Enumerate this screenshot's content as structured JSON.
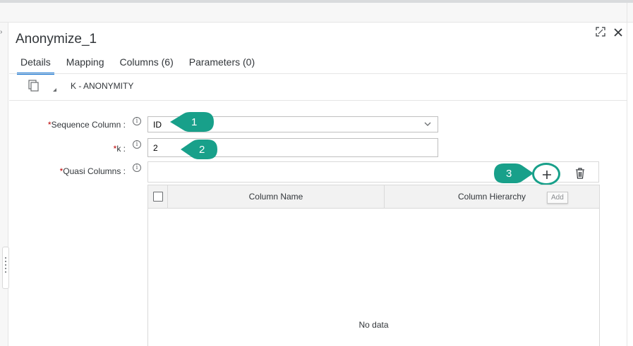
{
  "window": {
    "title": "Anonymize_1"
  },
  "tabs": [
    {
      "label": "Details",
      "active": true
    },
    {
      "label": "Mapping"
    },
    {
      "label": "Columns (6)"
    },
    {
      "label": "Parameters (0)"
    }
  ],
  "toolbar": {
    "method_label": "K - ANONYMITY"
  },
  "form": {
    "sequence_column": {
      "label": "Sequence Column :",
      "required_mark": "*",
      "value": "ID"
    },
    "k": {
      "label": "k :",
      "required_mark": "*",
      "value": "2"
    },
    "quasi_columns": {
      "label": "Quasi Columns :",
      "required_mark": "*"
    }
  },
  "table": {
    "columns": [
      "Column Name",
      "Column Hierarchy"
    ],
    "empty_text": "No data"
  },
  "tooltip": {
    "add": "Add"
  },
  "callouts": [
    "1",
    "2",
    "3"
  ],
  "colors": {
    "accent": "#0a6ed1",
    "callout": "#18a08a",
    "required": "#bb0000"
  },
  "icons": [
    "expand-icon",
    "close-icon",
    "copy-icon",
    "info-icon",
    "chevron-down-icon",
    "add-icon",
    "trash-icon"
  ]
}
